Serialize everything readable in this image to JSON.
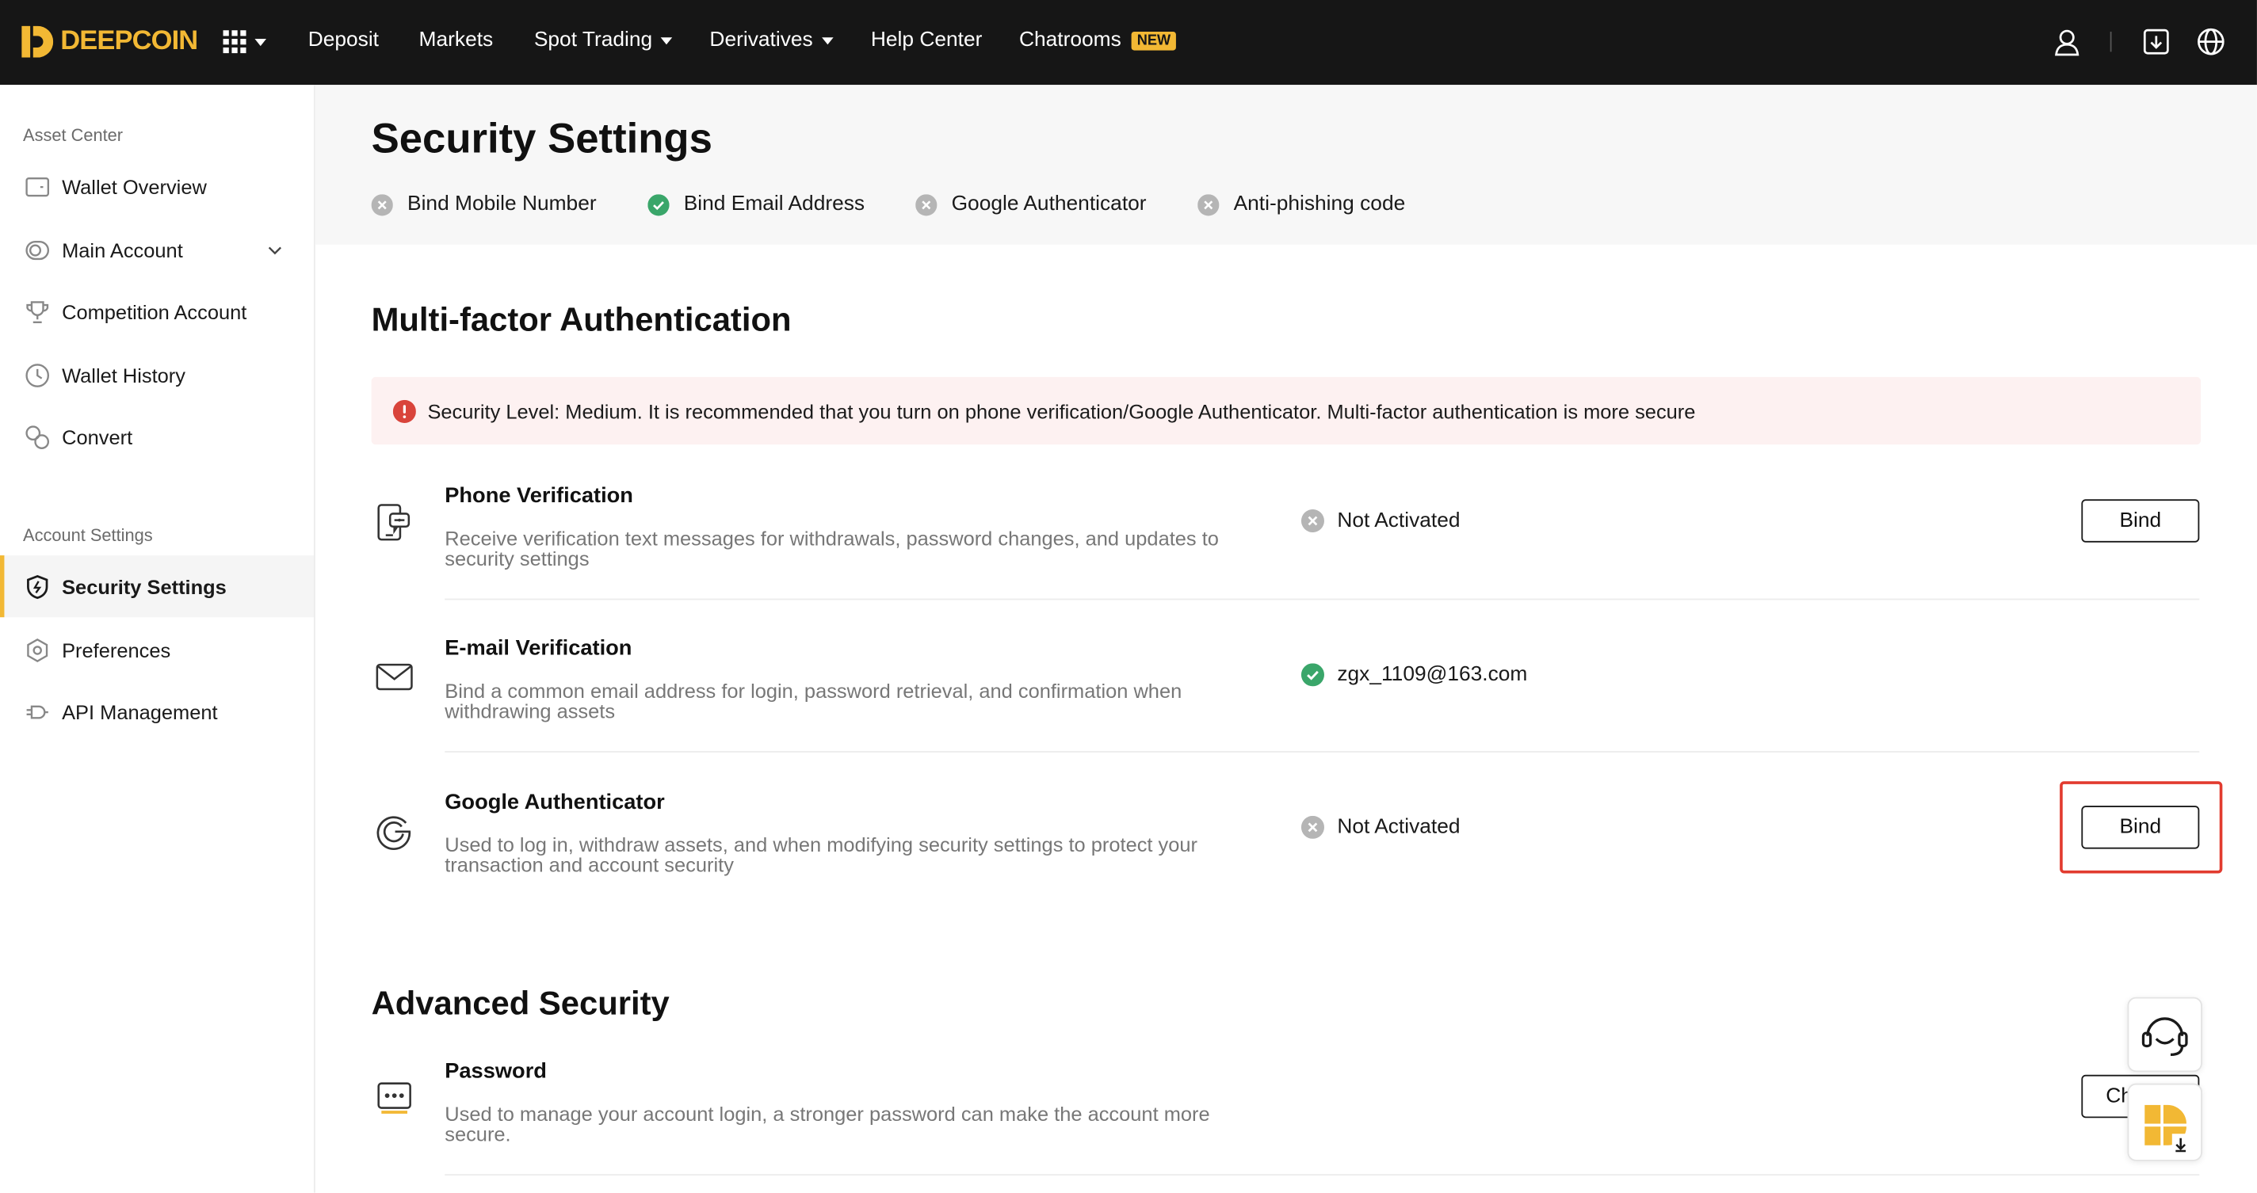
{
  "brand": {
    "name": "DEEPCOIN",
    "accent": "#f2b834"
  },
  "nav": {
    "items": [
      {
        "label": "Deposit"
      },
      {
        "label": "Markets"
      },
      {
        "label": "Spot Trading"
      },
      {
        "label": "Derivatives"
      },
      {
        "label": "Help Center"
      },
      {
        "label": "Chatrooms",
        "badge": "NEW"
      }
    ]
  },
  "sidebar": {
    "asset_section": "Asset Center",
    "asset_items": [
      {
        "label": "Wallet Overview",
        "icon": "wallet-icon"
      },
      {
        "label": "Main Account",
        "icon": "account-icon"
      },
      {
        "label": "Competition Account",
        "icon": "trophy-icon"
      },
      {
        "label": "Wallet History",
        "icon": "clock-icon"
      },
      {
        "label": "Convert",
        "icon": "convert-icon"
      }
    ],
    "settings_section": "Account Settings",
    "settings_items": [
      {
        "label": "Security Settings",
        "icon": "shield-icon"
      },
      {
        "label": "Preferences",
        "icon": "hexagon-icon"
      },
      {
        "label": "API Management",
        "icon": "api-icon"
      }
    ]
  },
  "page": {
    "title": "Security Settings",
    "status": [
      {
        "label": "Bind Mobile Number",
        "state": "inactive"
      },
      {
        "label": "Bind Email Address",
        "state": "active"
      },
      {
        "label": "Google Authenticator",
        "state": "inactive"
      },
      {
        "label": "Anti-phishing code",
        "state": "inactive"
      }
    ],
    "mfa_title": "Multi-factor Authentication",
    "alert": "Security Level: Medium. It is recommended that you turn on phone verification/Google Authenticator. Multi-factor authentication is more secure",
    "mfa_rows": [
      {
        "title": "Phone Verification",
        "desc": "Receive verification text messages for withdrawals, password changes, and updates to security settings",
        "status": "Not Activated",
        "state": "inactive",
        "button": "Bind"
      },
      {
        "title": "E-mail Verification",
        "desc": "Bind a common email address for login, password retrieval, and confirmation when withdrawing assets",
        "status": "zgx_1109@163.com",
        "state": "active"
      },
      {
        "title": "Google Authenticator",
        "desc": "Used to log in, withdraw assets, and when modifying security settings to protect your transaction and account security",
        "status": "Not Activated",
        "state": "inactive",
        "button": "Bind"
      }
    ],
    "advanced_title": "Advanced Security",
    "advanced_rows": [
      {
        "title": "Password",
        "desc": "Used to manage your account login, a stronger password can make the account more secure.",
        "button": "Ch"
      }
    ]
  },
  "colors": {
    "success": "#3aa66a",
    "inactive": "#b5b5b5",
    "alert_bg": "#fdf1f1",
    "alert_icon": "#d9443b",
    "highlight": "#e23b2f"
  }
}
